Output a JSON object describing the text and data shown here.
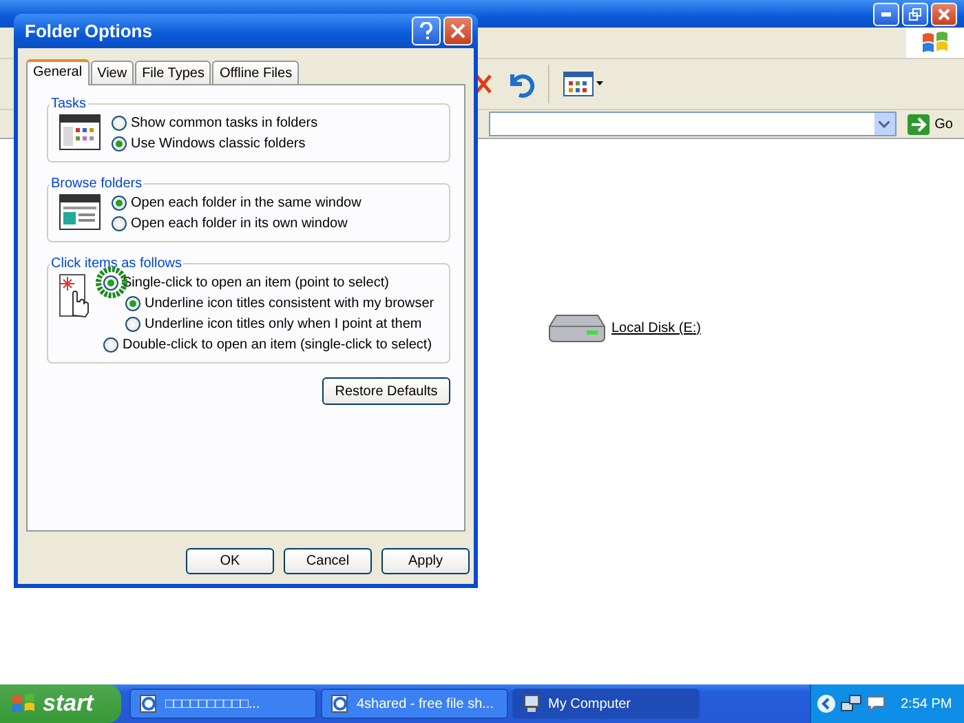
{
  "explorer": {
    "go_button": "Go",
    "items": [
      {
        "label": "Local Disk (E:)"
      }
    ]
  },
  "dialog": {
    "title": "Folder Options",
    "tabs": [
      {
        "label": "General",
        "selected": true
      },
      {
        "label": "View",
        "selected": false
      },
      {
        "label": "File Types",
        "selected": false
      },
      {
        "label": "Offline Files",
        "selected": false
      }
    ],
    "groups": [
      {
        "title": "Tasks",
        "options": [
          {
            "label": "Show common tasks in folders",
            "selected": false
          },
          {
            "label": "Use Windows classic folders",
            "selected": true
          }
        ]
      },
      {
        "title": "Browse folders",
        "options": [
          {
            "label": "Open each folder in the same window",
            "selected": true
          },
          {
            "label": "Open each folder in its own window",
            "selected": false
          }
        ]
      },
      {
        "title": "Click items as follows",
        "options": [
          {
            "label": "Single-click to open an item (point to select)",
            "selected": true,
            "children": [
              {
                "label": "Underline icon titles consistent with my browser",
                "selected": true
              },
              {
                "label": "Underline icon titles only when I point at them",
                "selected": false
              }
            ]
          },
          {
            "label": "Double-click to open an item (single-click to select)",
            "selected": false
          }
        ]
      }
    ],
    "restore_button": "Restore Defaults",
    "buttons": [
      "OK",
      "Cancel",
      "Apply"
    ]
  },
  "taskbar": {
    "start": "start",
    "tasks": [
      {
        "label": "□□□□□□□□□□...",
        "selected": false
      },
      {
        "label": "4shared - free file sh...",
        "selected": false
      },
      {
        "label": "My Computer",
        "selected": true
      }
    ],
    "clock": "2:54 PM"
  }
}
